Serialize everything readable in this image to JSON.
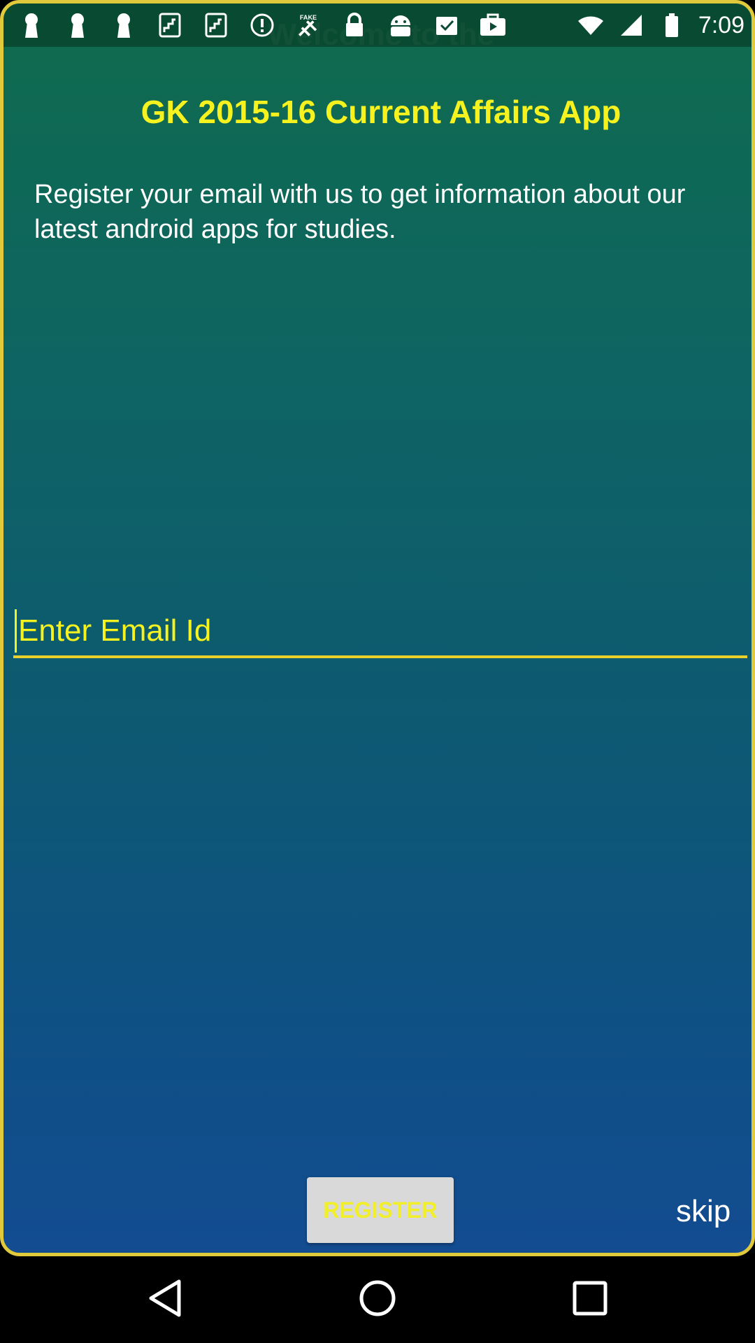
{
  "status_bar": {
    "time": "7:09",
    "left_icons": [
      "keyhole-icon",
      "keyhole-icon",
      "keyhole-icon",
      "stairs-icon",
      "stairs-icon",
      "alert-icon",
      "fake-gps-icon",
      "lock-icon",
      "android-icon",
      "inbox-check-icon",
      "briefcase-play-icon"
    ],
    "fake_label": "FAKE",
    "right_icons": [
      "wifi-icon",
      "signal-icon",
      "battery-icon"
    ]
  },
  "screen": {
    "welcome": "Welcome to the",
    "app_title": "GK 2015-16 Current Affairs App",
    "description": "Register your email with us to get information about our latest android apps for studies.",
    "email_placeholder": "Enter Email Id",
    "email_value": "",
    "register_label": "REGISTER",
    "skip_label": "skip"
  },
  "colors": {
    "accent_yellow": "#f5f21f",
    "border_gold": "#e0c93a",
    "bg_top": "#0f6b4d",
    "bg_bottom": "#134c91"
  },
  "nav_bar": {
    "buttons": [
      "back-icon",
      "home-icon",
      "recents-icon"
    ]
  }
}
